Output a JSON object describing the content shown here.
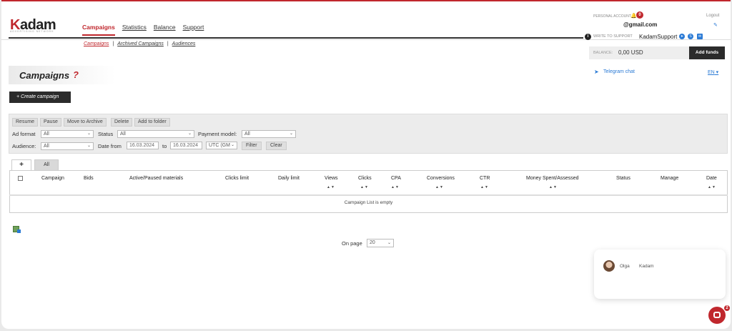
{
  "brand": {
    "logo_k": "K",
    "logo_rest": "adam",
    "tagline": "ADVERTISING NETWORK"
  },
  "nav": {
    "items": [
      "Campaigns",
      "Statistics",
      "Balance",
      "Support"
    ]
  },
  "subnav": {
    "items": [
      "Campaigns",
      "Archived Campaigns",
      "Audiences"
    ],
    "separator": "|"
  },
  "account": {
    "label": "PERSONAL ACCOUNT",
    "notifications": "0",
    "email": "@gmail.com",
    "logout": "Logout",
    "write_support_label": "WRITE TO SUPPORT",
    "support_name": "KadamSupport",
    "balance_label": "BALANCE:",
    "balance_value": "0,00 USD",
    "add_funds": "Add funds",
    "telegram": "Telegram chat",
    "language": "EN"
  },
  "page": {
    "title": "Campaigns",
    "help": "?",
    "create_button": "+ Create campaign"
  },
  "filters": {
    "actions": [
      "Resume",
      "Pause",
      "Move to Archive",
      "Delete",
      "Add to folder"
    ],
    "ad_format_label": "Ad format",
    "ad_format_value": "All",
    "status_label": "Status",
    "status_value": "All",
    "payment_label": "Payment model:",
    "payment_value": "All",
    "audience_label": "Audience:",
    "audience_value": "All",
    "date_from_label": "Date from",
    "date_from": "16.03.2024",
    "to_label": "to",
    "date_to": "16.03.2024",
    "timezone": "UTC (GM",
    "filter_button": "Filter",
    "clear_button": "Clear"
  },
  "tabs": {
    "plus": "+",
    "all": "All"
  },
  "table": {
    "columns": [
      "Campaign",
      "Bids",
      "Active/Paused materials",
      "Clicks limit",
      "Daily limit",
      "Views",
      "Clicks",
      "CPA",
      "Conversions",
      "CTR",
      "Money Spent/Assessed",
      "Status",
      "Manage",
      "Date"
    ],
    "sort_glyph": "▲▼",
    "empty_text": "Campaign List is empty"
  },
  "pagination": {
    "label": "On page",
    "value": "20"
  },
  "chat": {
    "agent": "Olga",
    "company": "Kadam",
    "badge": "2"
  }
}
